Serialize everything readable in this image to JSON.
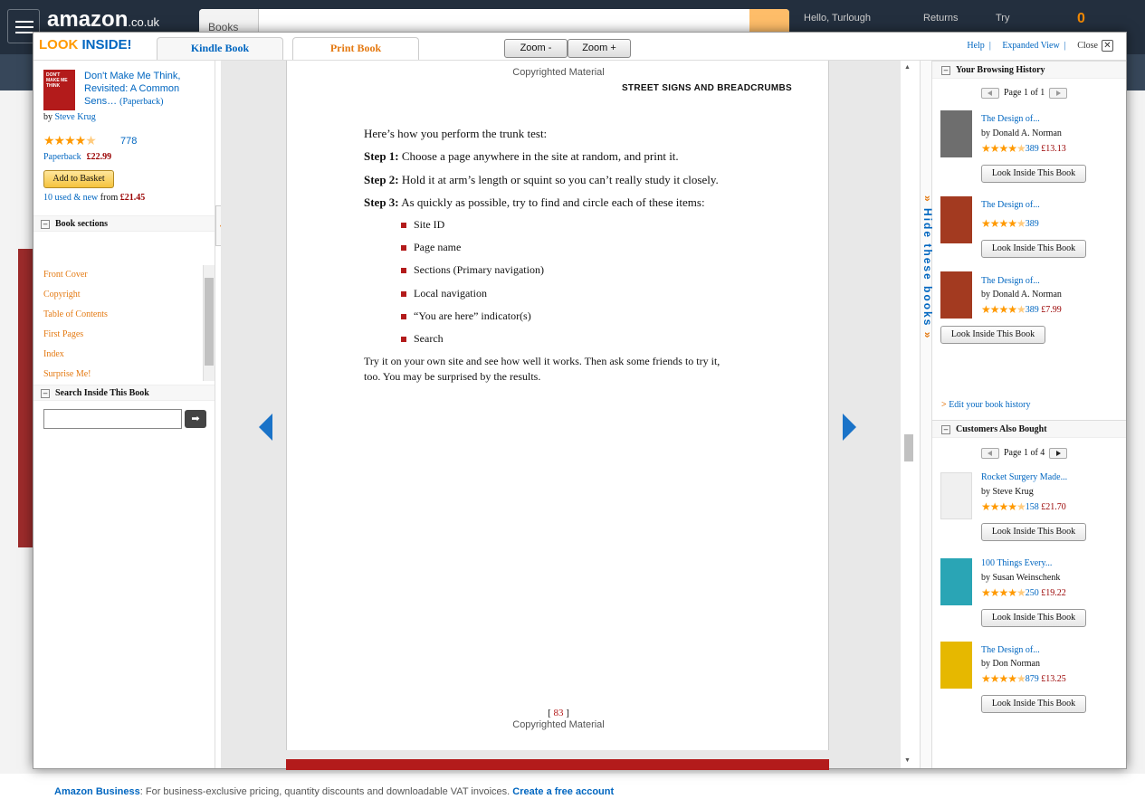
{
  "amazon_nav": {
    "logo": "amazon",
    "logo_suffix": ".co.uk",
    "search_dept": "Books",
    "greeting": "Hello, Turlough",
    "returns": "Returns",
    "try": "Try",
    "basket_count": "0"
  },
  "footer": {
    "business_link": "Amazon Business",
    "business_text": ": For business-exclusive pricing, quantity discounts and downloadable VAT invoices.",
    "create_link": "Create a free account"
  },
  "modal": {
    "brand_look": "LOOK",
    "brand_inside": "INSIDE!",
    "tabs": [
      "Kindle Book",
      "Print Book"
    ],
    "zoom_minus": "Zoom -",
    "zoom_plus": "Zoom +",
    "help": "Help",
    "expanded_view": "Expanded View",
    "close": "Close"
  },
  "left": {
    "book_title": "Don't Make Me Think, Revisited: A Common Sens…",
    "book_format_paren": "(Paperback)",
    "by": "by",
    "author": "Steve Krug",
    "rating": 4.5,
    "review_count": "778",
    "format": "Paperback",
    "price": "£22.99",
    "add_to_basket": "Add to Basket",
    "used_new": "10 used & new",
    "used_from": "from",
    "used_price": "£21.45",
    "sections_header": "Book sections",
    "sections": [
      "Front Cover",
      "Copyright",
      "Table of Contents",
      "First Pages",
      "Index",
      "Surprise Me!"
    ],
    "search_header": "Search Inside This Book",
    "search_value": "",
    "search_go": "➡"
  },
  "page": {
    "copyright_top": "Copyrighted Material",
    "running_head": "STREET SIGNS AND BREADCRUMBS",
    "intro": "Here’s how you perform the trunk test:",
    "steps": [
      {
        "label": "Step 1:",
        "text": "Choose a page anywhere in the site at random, and print it."
      },
      {
        "label": "Step 2:",
        "text": "Hold it at arm’s length or squint so you can’t really study it closely."
      },
      {
        "label": "Step 3:",
        "text": "As quickly as possible, try to find and circle each of these items:"
      }
    ],
    "bullets": [
      "Site ID",
      "Page name",
      "Sections (Primary navigation)",
      "Local navigation",
      "“You are here” indicator(s)",
      "Search"
    ],
    "closing_line1": "Try it on your own site and see how well it works. Then ask some friends to try it,",
    "closing_line2": "too. You may be surprised by the results.",
    "page_number": "83",
    "copyright_bottom": "Copyrighted Material"
  },
  "hide_books": "Hide these books",
  "right": {
    "history_header": "Your Browsing History",
    "history_pager": "Page 1 of 1",
    "history": [
      {
        "title": "The Design of...",
        "author": "by Donald A. Norman",
        "count": "389",
        "price": "£13.13",
        "button": "Look Inside This Book",
        "cover": "#6e6e6e"
      },
      {
        "title": "The Design of...",
        "author": "",
        "count": "389",
        "price": "",
        "button": "Look Inside This Book",
        "cover": "#a33a20"
      },
      {
        "title": "The Design of...",
        "author": "by Donald A. Norman",
        "count": "389",
        "price": "£7.99",
        "button": "Look Inside This Book",
        "cover": "#a33a20"
      }
    ],
    "edit_history": "Edit your book history",
    "also_header": "Customers Also Bought",
    "also_pager": "Page 1 of 4",
    "also": [
      {
        "title": "Rocket Surgery Made...",
        "author": "by Steve Krug",
        "count": "158",
        "price": "£21.70",
        "button": "Look Inside This Book",
        "cover": "#f0f0f0"
      },
      {
        "title": "100 Things Every...",
        "author": "by Susan Weinschenk",
        "count": "250",
        "price": "£19.22",
        "button": "Look Inside This Book",
        "cover": "#2aa5b5"
      },
      {
        "title": "The Design of...",
        "author": "by Don Norman",
        "count": "879",
        "price": "£13.25",
        "button": "Look Inside This Book",
        "cover": "#e6b800"
      }
    ]
  },
  "colors": {
    "accent_orange": "#e47911",
    "link_blue": "#0066c0",
    "price_red": "#990000",
    "star": "#ff9900"
  }
}
